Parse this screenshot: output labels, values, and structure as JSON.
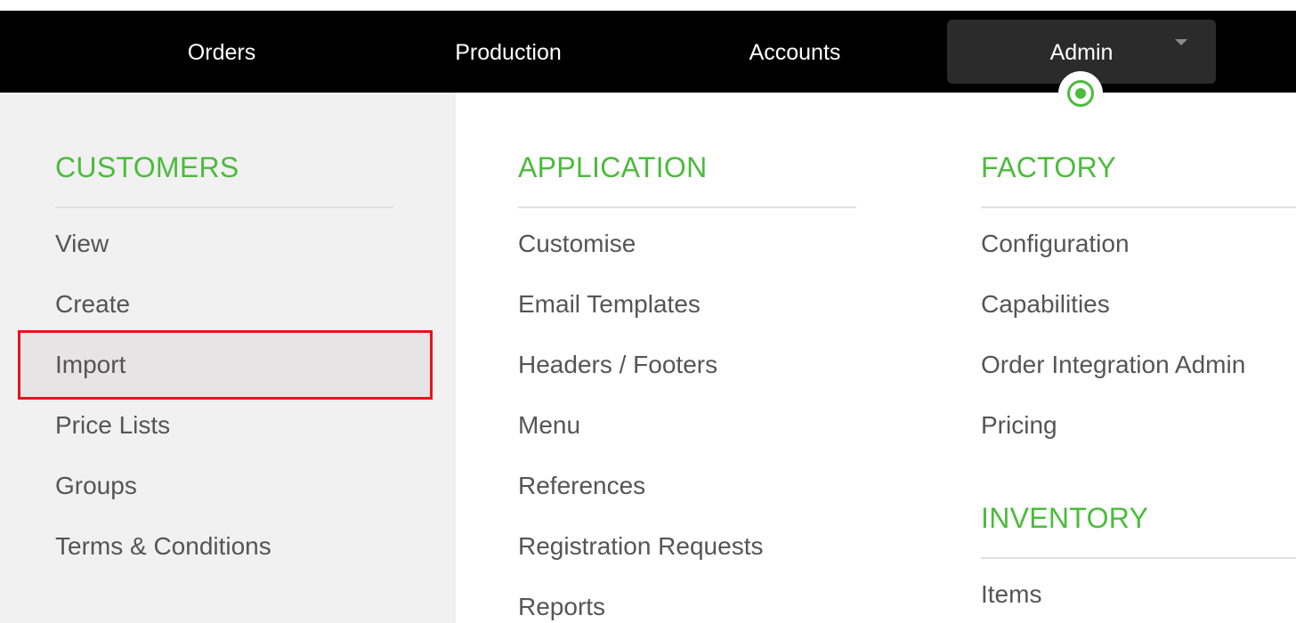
{
  "nav": {
    "orders": "Orders",
    "production": "Production",
    "accounts": "Accounts",
    "admin": "Admin"
  },
  "menu": {
    "customers": {
      "title": "CUSTOMERS",
      "items": [
        "View",
        "Create",
        "Import",
        "Price Lists",
        "Groups",
        "Terms & Conditions"
      ]
    },
    "application": {
      "title": "APPLICATION",
      "items": [
        "Customise",
        "Email Templates",
        "Headers / Footers",
        "Menu",
        "References",
        "Registration Requests",
        "Reports"
      ]
    },
    "factory": {
      "title": "FACTORY",
      "items": [
        "Configuration",
        "Capabilities",
        "Order Integration Admin",
        "Pricing"
      ]
    },
    "inventory": {
      "title": "INVENTORY",
      "items": [
        "Items"
      ]
    }
  },
  "colors": {
    "accent": "#4cbb3c",
    "highlight_border": "#e8121b",
    "navbar": "#000000"
  },
  "icons": {
    "admin_caret": "chevron-down-icon",
    "active_marker": "target-icon"
  }
}
